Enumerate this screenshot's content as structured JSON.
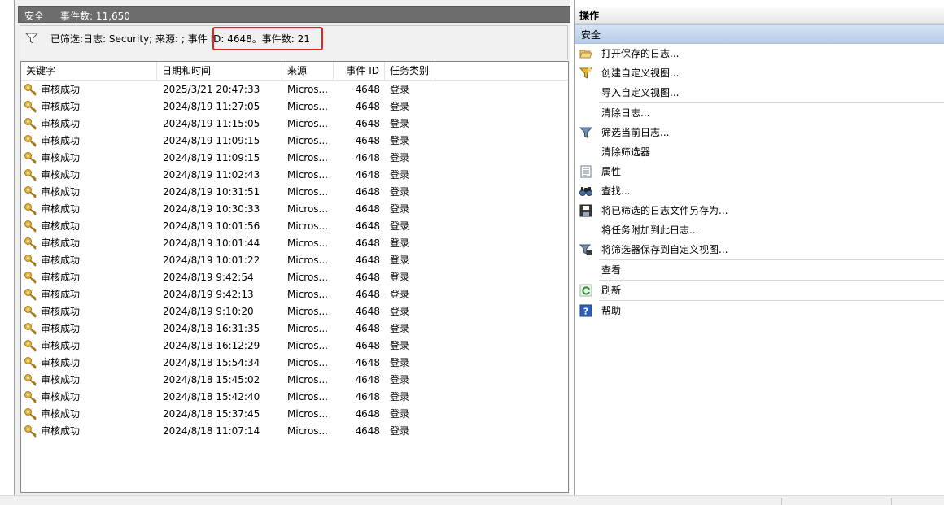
{
  "main": {
    "header": {
      "title": "安全",
      "count": "事件数: 11,650"
    },
    "filter_text": "已筛选:日志: Security; 来源: ; 事件 ID: 4648。事件数: 21",
    "columns": [
      "关键字",
      "日期和时间",
      "来源",
      "事件 ID",
      "任务类别"
    ],
    "rows": [
      [
        "审核成功",
        "2025/3/21 20:47:33",
        "Micros...",
        "4648",
        "登录"
      ],
      [
        "审核成功",
        "2024/8/19 11:27:05",
        "Micros...",
        "4648",
        "登录"
      ],
      [
        "审核成功",
        "2024/8/19 11:15:05",
        "Micros...",
        "4648",
        "登录"
      ],
      [
        "审核成功",
        "2024/8/19 11:09:15",
        "Micros...",
        "4648",
        "登录"
      ],
      [
        "审核成功",
        "2024/8/19 11:09:15",
        "Micros...",
        "4648",
        "登录"
      ],
      [
        "审核成功",
        "2024/8/19 11:02:43",
        "Micros...",
        "4648",
        "登录"
      ],
      [
        "审核成功",
        "2024/8/19 10:31:51",
        "Micros...",
        "4648",
        "登录"
      ],
      [
        "审核成功",
        "2024/8/19 10:30:33",
        "Micros...",
        "4648",
        "登录"
      ],
      [
        "审核成功",
        "2024/8/19 10:01:56",
        "Micros...",
        "4648",
        "登录"
      ],
      [
        "审核成功",
        "2024/8/19 10:01:44",
        "Micros...",
        "4648",
        "登录"
      ],
      [
        "审核成功",
        "2024/8/19 10:01:22",
        "Micros...",
        "4648",
        "登录"
      ],
      [
        "审核成功",
        "2024/8/19 9:42:54",
        "Micros...",
        "4648",
        "登录"
      ],
      [
        "审核成功",
        "2024/8/19 9:42:13",
        "Micros...",
        "4648",
        "登录"
      ],
      [
        "审核成功",
        "2024/8/19 9:10:20",
        "Micros...",
        "4648",
        "登录"
      ],
      [
        "审核成功",
        "2024/8/18 16:31:35",
        "Micros...",
        "4648",
        "登录"
      ],
      [
        "审核成功",
        "2024/8/18 16:12:29",
        "Micros...",
        "4648",
        "登录"
      ],
      [
        "审核成功",
        "2024/8/18 15:54:34",
        "Micros...",
        "4648",
        "登录"
      ],
      [
        "审核成功",
        "2024/8/18 15:45:02",
        "Micros...",
        "4648",
        "登录"
      ],
      [
        "审核成功",
        "2024/8/18 15:42:40",
        "Micros...",
        "4648",
        "登录"
      ],
      [
        "审核成功",
        "2024/8/18 15:37:45",
        "Micros...",
        "4648",
        "登录"
      ],
      [
        "审核成功",
        "2024/8/18 11:07:14",
        "Micros...",
        "4648",
        "登录"
      ]
    ]
  },
  "actions": {
    "title": "操作",
    "section": "安全",
    "items": [
      {
        "label": "打开保存的日志...",
        "icon": "open-folder-icon"
      },
      {
        "label": "创建自定义视图...",
        "icon": "create-filter-icon"
      },
      {
        "label": "导入自定义视图...",
        "icon": ""
      },
      {
        "label": "清除日志...",
        "icon": ""
      },
      {
        "label": "筛选当前日志...",
        "icon": "filter-icon"
      },
      {
        "label": "清除筛选器",
        "icon": ""
      },
      {
        "label": "属性",
        "icon": "properties-icon"
      },
      {
        "label": "查找...",
        "icon": "binoculars-icon"
      },
      {
        "label": "将已筛选的日志文件另存为...",
        "icon": "save-icon"
      },
      {
        "label": "将任务附加到此日志...",
        "icon": ""
      },
      {
        "label": "将筛选器保存到自定义视图...",
        "icon": "save-filter-icon"
      },
      {
        "label": "查看",
        "icon": ""
      },
      {
        "label": "刷新",
        "icon": "refresh-icon"
      },
      {
        "label": "帮助",
        "icon": "help-icon"
      }
    ]
  },
  "colors": {
    "highlight": "#e8231f",
    "header_bg": "#6d6d6d",
    "section_bg": "#c5d8ee"
  }
}
